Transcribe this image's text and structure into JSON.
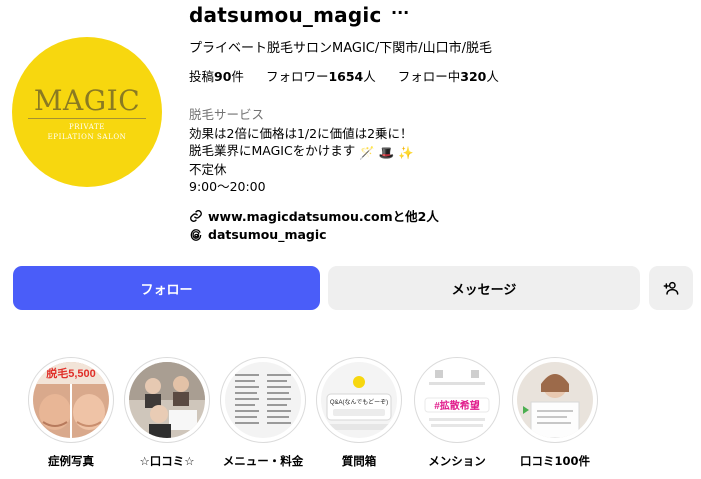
{
  "profile": {
    "username": "datsumou_magic",
    "more": "···",
    "fullname": "プライベート脱毛サロンMAGIC/下関市/山口市/脱毛",
    "stats": {
      "posts_label": "投稿",
      "posts_value": "90",
      "posts_unit": "件",
      "followers_label": "フォロワー",
      "followers_value": "1654",
      "followers_unit": "人",
      "following_label": "フォロー中",
      "following_value": "320",
      "following_unit": "人"
    },
    "category": "脱毛サービス",
    "bio": {
      "line1": "効果は2倍に価格は1/2に価値は2乗に！",
      "line2": "脱毛業界にMAGICをかけます",
      "line2_emoji": [
        "🪄",
        "🎩",
        "✨"
      ],
      "line3": "不定休",
      "line4": "9:00〜20:00"
    },
    "link": "www.magicdatsumou.comと他2人",
    "threads": "datsumou_magic",
    "avatar": {
      "logo_main": "MAGIC",
      "logo_sub1": "PRIVATE",
      "logo_sub2": "EPILATION SALON",
      "color": "#f7d70f"
    }
  },
  "buttons": {
    "follow": "フォロー",
    "message": "メッセージ",
    "add_user_icon": "person-add-icon"
  },
  "highlights": [
    {
      "label": "症例写真",
      "thumb_text": "脱毛5,500"
    },
    {
      "label": "☆口コミ☆",
      "thumb_text": ""
    },
    {
      "label": "メニュー・料金",
      "thumb_text": ""
    },
    {
      "label": "質問箱",
      "thumb_text": "Q&A(なんでもどーぞ)"
    },
    {
      "label": "メンション",
      "thumb_text": "#拡散希望"
    },
    {
      "label": "口コミ100件",
      "thumb_text": ""
    }
  ],
  "colors": {
    "accent": "#4a5df9",
    "secondary_button": "#efefef",
    "muted_text": "#737373"
  }
}
